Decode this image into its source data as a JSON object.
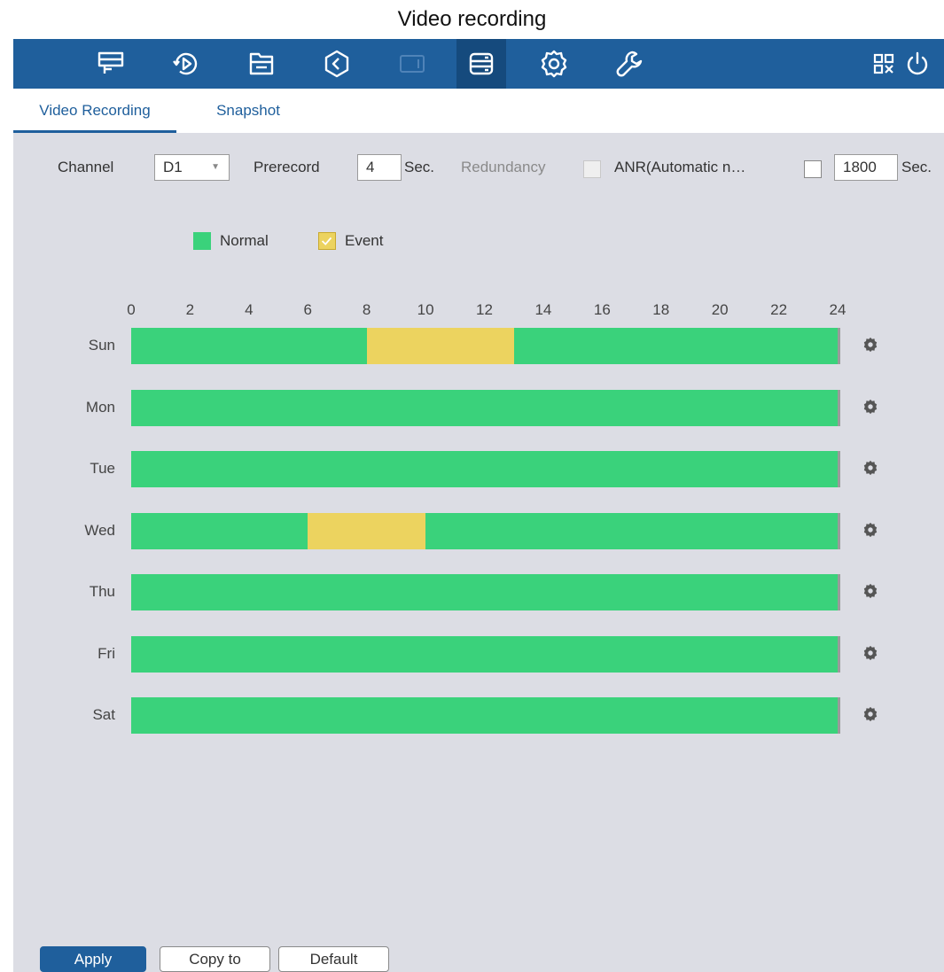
{
  "window": {
    "title": "Video recording"
  },
  "topbar": {
    "icons": [
      "live-view",
      "playback",
      "file-manager",
      "alarm-history",
      "camera",
      "storage",
      "settings",
      "maintenance"
    ],
    "right_icons": [
      "qr-code",
      "power"
    ],
    "active_icon": "storage"
  },
  "tabs": [
    {
      "label": "Video Recording",
      "active": true
    },
    {
      "label": "Snapshot",
      "active": false
    }
  ],
  "settings": {
    "channel_label": "Channel",
    "channel_value": "D1",
    "prerecord_label": "Prerecord",
    "prerecord_value": "4",
    "prerecord_unit": "Sec.",
    "redundancy_label": "Redundancy",
    "anr_label": "ANR(Automatic n…",
    "anr_value": "1800",
    "anr_unit": "Sec."
  },
  "legend": {
    "normal_label": "Normal",
    "event_label": "Event"
  },
  "colors": {
    "normal": "#3ad27b",
    "event": "#ecd35f",
    "accent": "#1f5f9c"
  },
  "schedule": {
    "hour_ticks": [
      "0",
      "2",
      "4",
      "6",
      "8",
      "10",
      "12",
      "14",
      "16",
      "18",
      "20",
      "22",
      "24"
    ],
    "days": [
      {
        "label": "Sun",
        "events": [
          [
            8,
            13
          ]
        ]
      },
      {
        "label": "Mon",
        "events": []
      },
      {
        "label": "Tue",
        "events": []
      },
      {
        "label": "Wed",
        "events": [
          [
            6,
            10
          ]
        ]
      },
      {
        "label": "Thu",
        "events": []
      },
      {
        "label": "Fri",
        "events": []
      },
      {
        "label": "Sat",
        "events": []
      }
    ]
  },
  "buttons": {
    "apply": "Apply",
    "copy_to": "Copy to",
    "default": "Default"
  }
}
